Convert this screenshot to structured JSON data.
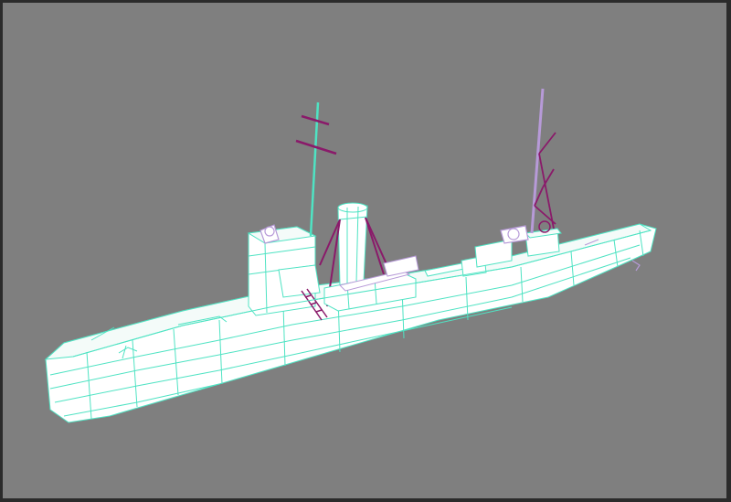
{
  "viewport": {
    "background": "#7f7f7f",
    "frame_color": "#2b2b2b",
    "render_mode": "wireframe"
  },
  "model": {
    "subject": "ship",
    "colors": {
      "hull_wire": "#4fe3c3",
      "hull_fill": "#ffffff",
      "rigging": "#8a1a6a",
      "accent_purple": "#b79ad8",
      "mast_cyan": "#4fe3c3"
    }
  }
}
